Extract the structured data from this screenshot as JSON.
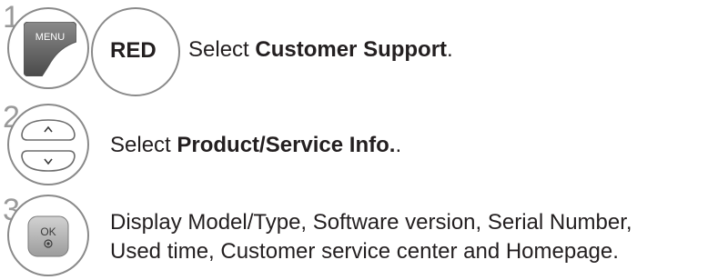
{
  "steps": [
    {
      "number": "1",
      "buttons": {
        "menu_label": "MENU",
        "red_label": "RED"
      },
      "text_prefix": "Select ",
      "text_bold": "Customer Support",
      "text_suffix": "."
    },
    {
      "number": "2",
      "buttons": {
        "up_label": "^",
        "down_label": "v"
      },
      "text_prefix": "Select ",
      "text_bold": "Product/Service Info.",
      "text_suffix": "."
    },
    {
      "number": "3",
      "buttons": {
        "ok_label": "OK"
      },
      "lines": [
        "Display Model/Type, Software version, Serial Number,",
        "Used time, Customer service center and Homepage."
      ]
    }
  ]
}
